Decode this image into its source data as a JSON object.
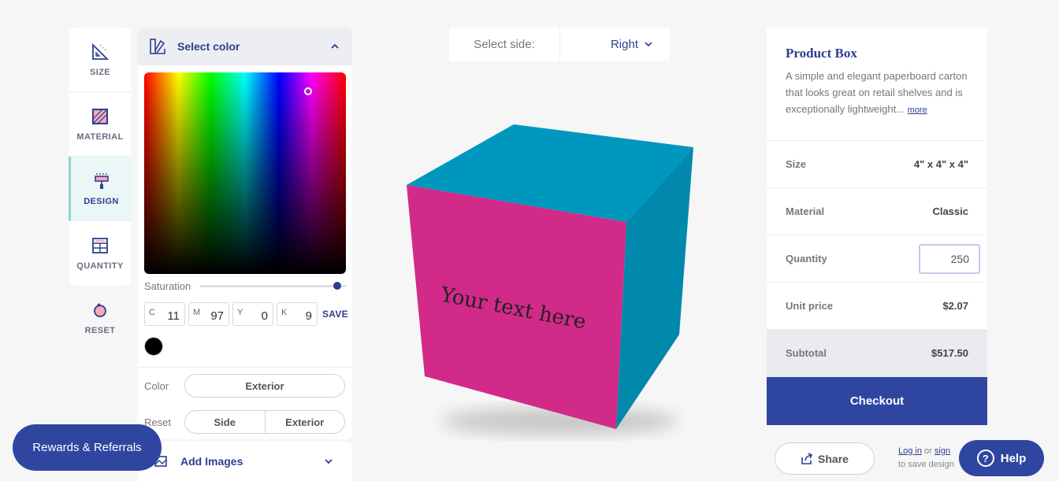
{
  "nav": {
    "items": [
      {
        "label": "SIZE",
        "icon": "ruler-triangle-icon"
      },
      {
        "label": "MATERIAL",
        "icon": "material-swatch-icon"
      },
      {
        "label": "DESIGN",
        "icon": "paint-roller-icon"
      },
      {
        "label": "QUANTITY",
        "icon": "calculator-icon"
      },
      {
        "label": "RESET",
        "icon": "reset-icon"
      }
    ],
    "active": "DESIGN"
  },
  "color_panel": {
    "title": "Select color",
    "saturation_label": "Saturation",
    "saturation_value": 0.97,
    "cmyk": [
      {
        "key": "C",
        "value": "11"
      },
      {
        "key": "M",
        "value": "97"
      },
      {
        "key": "Y",
        "value": "0"
      },
      {
        "key": "K",
        "value": "9"
      }
    ],
    "save_label": "SAVE",
    "current_swatch": "#000000",
    "color_row": {
      "label": "Color",
      "option": "Exterior"
    },
    "reset_row": {
      "label": "Reset",
      "options": [
        "Side",
        "Exterior"
      ]
    }
  },
  "images_panel": {
    "title": "Add Images"
  },
  "side_selector": {
    "label": "Select side:",
    "value": "Right"
  },
  "preview": {
    "cube_text": "Your text here",
    "front_color": "#d42a8a",
    "side_color": "#0096bf"
  },
  "product": {
    "title": "Product Box",
    "description": "A simple and elegant paperboard carton that looks great on retail shelves and is exceptionally lightweight...",
    "more_link": "more",
    "rows": {
      "size": {
        "label": "Size",
        "value": "4\" x 4\" x 4\""
      },
      "material": {
        "label": "Material",
        "value": "Classic"
      },
      "quantity": {
        "label": "Quantity",
        "value": "250"
      },
      "unit_price": {
        "label": "Unit price",
        "value": "$2.07"
      },
      "subtotal": {
        "label": "Subtotal",
        "value": "$517.50"
      }
    },
    "checkout_label": "Checkout"
  },
  "share_label": "Share",
  "login": {
    "log_in": "Log in",
    "or": "or",
    "sign": "sign",
    "line2": "to save design"
  },
  "help_label": "Help",
  "rewards_label": "Rewards & Referrals",
  "colors": {
    "accent": "#2e46a0",
    "active_bg": "#eaf7f6"
  }
}
